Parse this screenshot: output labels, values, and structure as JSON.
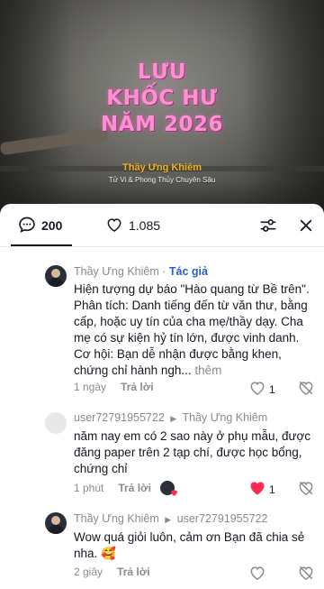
{
  "video": {
    "title_lines": [
      "LƯU",
      "KHỐC HƯ",
      "NĂM 2026"
    ],
    "author": "Thầy Ưng Khiêm",
    "author_subtitle": "Tử Vi & Phong Thủy Chuyên Sâu"
  },
  "sheet": {
    "comments_count": "200",
    "likes_count": "1.085",
    "comment_icon": "comment-bubble-icon",
    "like_icon": "heart-outline-icon",
    "filter_icon": "sliders-icon",
    "close_icon": "close-icon"
  },
  "comments": [
    {
      "author": "Thầy Ưng Khiêm",
      "separator": "·",
      "tag": "Tác giả",
      "text": "Hiện tượng dự báo \"Hào quang từ Bề trên\". Phân tích: Danh tiếng đến từ văn thư, bằng cấp, hoặc uy tín của cha mẹ/thầy dạy. Cha mẹ có sự kiện hỷ tín lớn, được vinh danh. Cơ hội: Bạn dễ nhận được bằng khen, chứng chỉ hành ngh...",
      "more": "thêm",
      "time": "1 ngày",
      "reply": "Trả lời",
      "likes": "1"
    },
    {
      "author": "user72791955722",
      "reply_to": "Thầy Ưng Khiêm",
      "text": "năm nay em có 2 sao này ở phụ mẫu, được đăng paper trên 2 tạp chí, được học bổng, chứng chỉ",
      "time": "1 phút",
      "reply": "Trả lời",
      "likes": "1"
    },
    {
      "author": "Thầy Ưng Khiêm",
      "reply_to": "user72791955722",
      "text": "Wow quá giỏi luôn, cảm ơn Bạn đã chia sẻ nha. 🥰",
      "time": "2 giây",
      "reply": "Trả lời"
    }
  ],
  "colors": {
    "accent_red": "#fe2c55",
    "author_tag": "#2c5bd7",
    "muted": "#8a8b91",
    "title_pink": "#ff8fd0",
    "author_gold": "#f2b21d"
  }
}
